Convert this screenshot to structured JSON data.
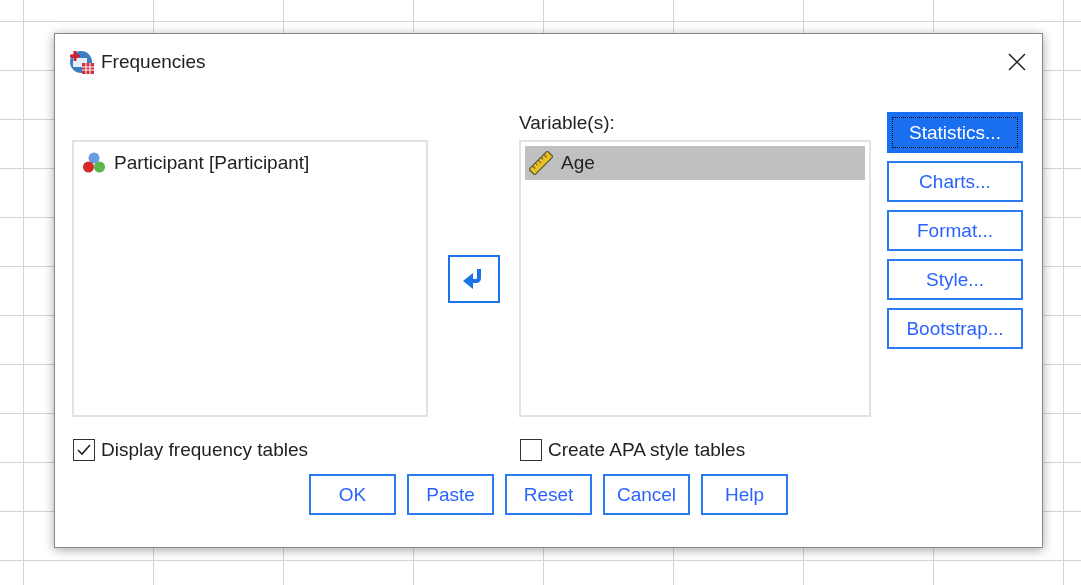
{
  "window": {
    "title": "Frequencies"
  },
  "source_list": {
    "items": [
      {
        "label": "Participant [Participant]",
        "kind": "nominal",
        "selected": false
      }
    ]
  },
  "variables": {
    "label": "Variable(s):",
    "items": [
      {
        "label": "Age",
        "kind": "scale",
        "selected": true
      }
    ]
  },
  "side_buttons": [
    {
      "label": "Statistics...",
      "selected": true
    },
    {
      "label": "Charts...",
      "selected": false
    },
    {
      "label": "Format...",
      "selected": false
    },
    {
      "label": "Style...",
      "selected": false
    },
    {
      "label": "Bootstrap...",
      "selected": false
    }
  ],
  "options": [
    {
      "label": "Display frequency tables",
      "checked": true
    },
    {
      "label": "Create APA style tables",
      "checked": false
    }
  ],
  "buttons": [
    "OK",
    "Paste",
    "Reset",
    "Cancel",
    "Help"
  ]
}
